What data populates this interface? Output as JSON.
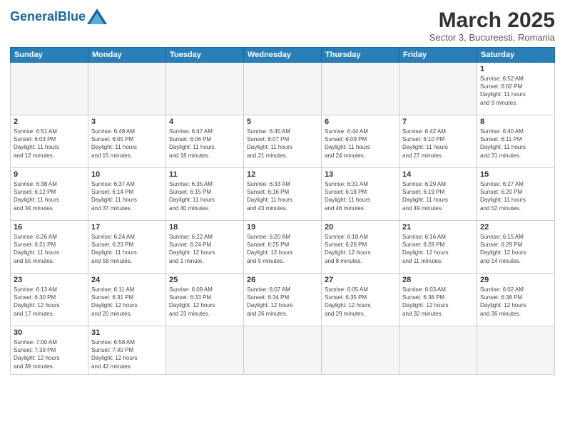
{
  "header": {
    "logo_general": "General",
    "logo_blue": "Blue",
    "month_title": "March 2025",
    "subtitle": "Sector 3, Bucureesti, Romania"
  },
  "weekdays": [
    "Sunday",
    "Monday",
    "Tuesday",
    "Wednesday",
    "Thursday",
    "Friday",
    "Saturday"
  ],
  "weeks": [
    [
      {
        "day": "",
        "info": ""
      },
      {
        "day": "",
        "info": ""
      },
      {
        "day": "",
        "info": ""
      },
      {
        "day": "",
        "info": ""
      },
      {
        "day": "",
        "info": ""
      },
      {
        "day": "",
        "info": ""
      },
      {
        "day": "1",
        "info": "Sunrise: 6:52 AM\nSunset: 6:02 PM\nDaylight: 11 hours\nand 9 minutes."
      }
    ],
    [
      {
        "day": "2",
        "info": "Sunrise: 6:51 AM\nSunset: 6:03 PM\nDaylight: 11 hours\nand 12 minutes."
      },
      {
        "day": "3",
        "info": "Sunrise: 6:49 AM\nSunset: 6:05 PM\nDaylight: 11 hours\nand 15 minutes."
      },
      {
        "day": "4",
        "info": "Sunrise: 6:47 AM\nSunset: 6:06 PM\nDaylight: 11 hours\nand 18 minutes."
      },
      {
        "day": "5",
        "info": "Sunrise: 6:45 AM\nSunset: 6:07 PM\nDaylight: 11 hours\nand 21 minutes."
      },
      {
        "day": "6",
        "info": "Sunrise: 6:44 AM\nSunset: 6:09 PM\nDaylight: 11 hours\nand 24 minutes."
      },
      {
        "day": "7",
        "info": "Sunrise: 6:42 AM\nSunset: 6:10 PM\nDaylight: 11 hours\nand 27 minutes."
      },
      {
        "day": "8",
        "info": "Sunrise: 6:40 AM\nSunset: 6:11 PM\nDaylight: 11 hours\nand 31 minutes."
      }
    ],
    [
      {
        "day": "9",
        "info": "Sunrise: 6:38 AM\nSunset: 6:12 PM\nDaylight: 11 hours\nand 34 minutes."
      },
      {
        "day": "10",
        "info": "Sunrise: 6:37 AM\nSunset: 6:14 PM\nDaylight: 11 hours\nand 37 minutes."
      },
      {
        "day": "11",
        "info": "Sunrise: 6:35 AM\nSunset: 6:15 PM\nDaylight: 11 hours\nand 40 minutes."
      },
      {
        "day": "12",
        "info": "Sunrise: 6:33 AM\nSunset: 6:16 PM\nDaylight: 11 hours\nand 43 minutes."
      },
      {
        "day": "13",
        "info": "Sunrise: 6:31 AM\nSunset: 6:18 PM\nDaylight: 11 hours\nand 46 minutes."
      },
      {
        "day": "14",
        "info": "Sunrise: 6:29 AM\nSunset: 6:19 PM\nDaylight: 11 hours\nand 49 minutes."
      },
      {
        "day": "15",
        "info": "Sunrise: 6:27 AM\nSunset: 6:20 PM\nDaylight: 11 hours\nand 52 minutes."
      }
    ],
    [
      {
        "day": "16",
        "info": "Sunrise: 6:26 AM\nSunset: 6:21 PM\nDaylight: 11 hours\nand 55 minutes."
      },
      {
        "day": "17",
        "info": "Sunrise: 6:24 AM\nSunset: 6:23 PM\nDaylight: 11 hours\nand 58 minutes."
      },
      {
        "day": "18",
        "info": "Sunrise: 6:22 AM\nSunset: 6:24 PM\nDaylight: 12 hours\nand 1 minute."
      },
      {
        "day": "19",
        "info": "Sunrise: 6:20 AM\nSunset: 6:25 PM\nDaylight: 12 hours\nand 5 minutes."
      },
      {
        "day": "20",
        "info": "Sunrise: 6:18 AM\nSunset: 6:26 PM\nDaylight: 12 hours\nand 8 minutes."
      },
      {
        "day": "21",
        "info": "Sunrise: 6:16 AM\nSunset: 6:28 PM\nDaylight: 12 hours\nand 11 minutes."
      },
      {
        "day": "22",
        "info": "Sunrise: 6:15 AM\nSunset: 6:29 PM\nDaylight: 12 hours\nand 14 minutes."
      }
    ],
    [
      {
        "day": "23",
        "info": "Sunrise: 6:13 AM\nSunset: 6:30 PM\nDaylight: 12 hours\nand 17 minutes."
      },
      {
        "day": "24",
        "info": "Sunrise: 6:11 AM\nSunset: 6:31 PM\nDaylight: 12 hours\nand 20 minutes."
      },
      {
        "day": "25",
        "info": "Sunrise: 6:09 AM\nSunset: 6:33 PM\nDaylight: 12 hours\nand 23 minutes."
      },
      {
        "day": "26",
        "info": "Sunrise: 6:07 AM\nSunset: 6:34 PM\nDaylight: 12 hours\nand 26 minutes."
      },
      {
        "day": "27",
        "info": "Sunrise: 6:05 AM\nSunset: 6:35 PM\nDaylight: 12 hours\nand 29 minutes."
      },
      {
        "day": "28",
        "info": "Sunrise: 6:03 AM\nSunset: 6:36 PM\nDaylight: 12 hours\nand 32 minutes."
      },
      {
        "day": "29",
        "info": "Sunrise: 6:02 AM\nSunset: 6:38 PM\nDaylight: 12 hours\nand 36 minutes."
      }
    ],
    [
      {
        "day": "30",
        "info": "Sunrise: 7:00 AM\nSunset: 7:39 PM\nDaylight: 12 hours\nand 39 minutes."
      },
      {
        "day": "31",
        "info": "Sunrise: 6:58 AM\nSunset: 7:40 PM\nDaylight: 12 hours\nand 42 minutes."
      },
      {
        "day": "",
        "info": ""
      },
      {
        "day": "",
        "info": ""
      },
      {
        "day": "",
        "info": ""
      },
      {
        "day": "",
        "info": ""
      },
      {
        "day": "",
        "info": ""
      }
    ]
  ]
}
